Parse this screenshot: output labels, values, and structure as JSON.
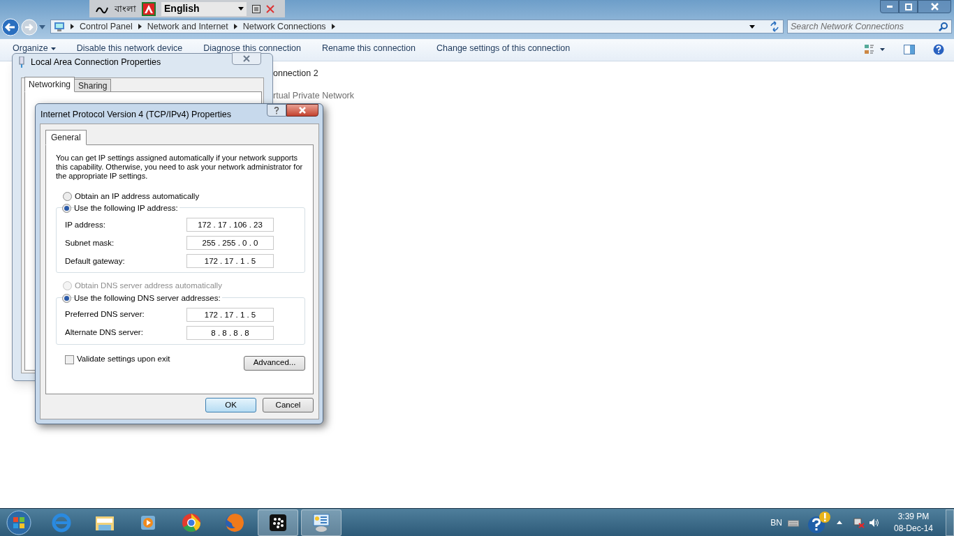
{
  "language_bar": {
    "script_name": "বাংলা",
    "language": "English"
  },
  "explorer": {
    "breadcrumb": [
      "Control Panel",
      "Network and Internet",
      "Network Connections"
    ],
    "search": {
      "placeholder": "Search Network Connections"
    },
    "toolbar": [
      "Organize",
      "Disable this network device",
      "Diagnose this connection",
      "Rename this connection",
      "Change settings of this connection"
    ],
    "items": [
      "onnection 2",
      "rtual Private Network"
    ]
  },
  "lan_dialog": {
    "title": "Local Area Connection Properties",
    "tabs": [
      {
        "label": "Networking",
        "selected": true
      },
      {
        "label": "Sharing",
        "selected": false
      }
    ]
  },
  "ipv4_dialog": {
    "title": "Internet Protocol Version 4 (TCP/IPv4) Properties",
    "tabs": [
      {
        "label": "General",
        "selected": true
      }
    ],
    "intro": "You can get IP settings assigned automatically if your network supports this capability. Otherwise, you need to ask your network administrator for the appropriate IP settings.",
    "ip_mode": [
      {
        "label": "Obtain an IP address automatically",
        "selected": false,
        "disabled": false
      },
      {
        "label": "Use the following IP address:",
        "selected": true,
        "disabled": false
      }
    ],
    "ip_fields": [
      {
        "label": "IP address:",
        "value": "172 . 17 . 106 . 23"
      },
      {
        "label": "Subnet mask:",
        "value": "255 . 255 . 0 . 0"
      },
      {
        "label": "Default gateway:",
        "value": "172 . 17 . 1 . 5"
      }
    ],
    "dns_mode": [
      {
        "label": "Obtain DNS server address automatically",
        "selected": false,
        "disabled": true
      },
      {
        "label": "Use the following DNS server addresses:",
        "selected": true,
        "disabled": false
      }
    ],
    "dns_fields": [
      {
        "label": "Preferred DNS server:",
        "value": "172 . 17 . 1 . 5"
      },
      {
        "label": "Alternate DNS server:",
        "value": "8 . 8 . 8 . 8"
      }
    ],
    "validate": {
      "label": "Validate settings upon exit",
      "checked": false
    },
    "advanced": "Advanced...",
    "buttons": [
      {
        "label": "OK",
        "default": true
      },
      {
        "label": "Cancel",
        "default": false
      }
    ]
  },
  "taskbar": {
    "apps": [
      {
        "kind": "ie",
        "running": false
      },
      {
        "kind": "folder",
        "running": false
      },
      {
        "kind": "media",
        "running": false
      },
      {
        "kind": "chrome",
        "running": false
      },
      {
        "kind": "firefox",
        "running": false
      },
      {
        "kind": "blackberry",
        "running": true
      },
      {
        "kind": "control",
        "running": true
      }
    ]
  },
  "tray": {
    "language": "BN",
    "time": "3:39 PM",
    "date": "08-Dec-14"
  }
}
